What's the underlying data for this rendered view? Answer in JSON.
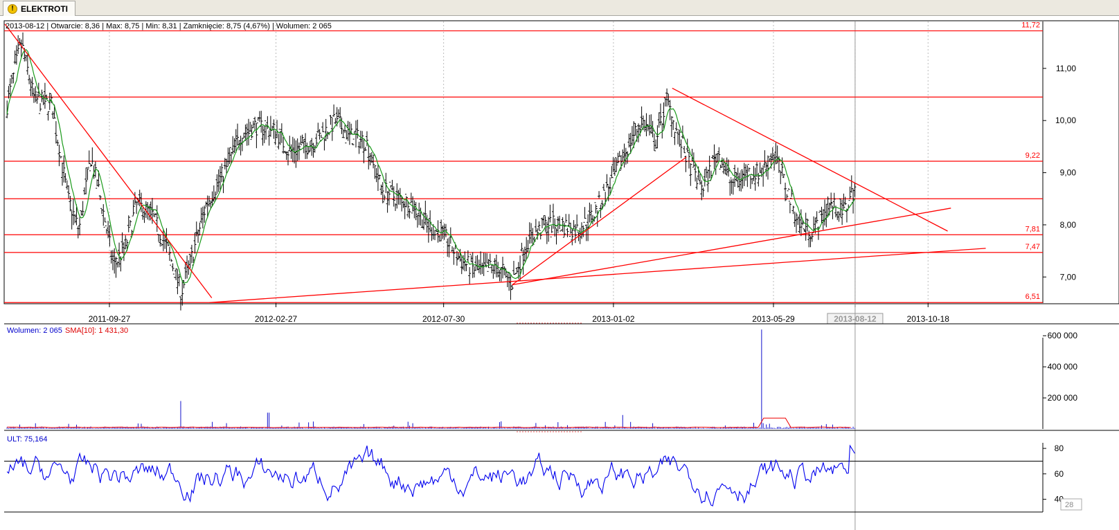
{
  "tab": {
    "label": "ELEKTROTI",
    "icon": "warning-icon"
  },
  "colors": {
    "price": "#000000",
    "sma": "#1a9a1a",
    "lines": "#ff0000",
    "volume": "#1010cc",
    "ult": "#0000ee"
  },
  "chart_data": [
    {
      "type": "bar",
      "title": "2013-08-12 | Otwarcie: 8,36 | Max: 8,75 | Min: 8,31 | Zamknięcie: 8,75 (4,67%)   | Wolumen: 2 065",
      "ylim": [
        6.5,
        11.9
      ],
      "yticks": [
        "7,00",
        "8,00",
        "9,00",
        "10,00",
        "11,00"
      ],
      "xticks": [
        "2011-09-27",
        "2012-02-27",
        "2012-07-30",
        "2013-01-02",
        "2013-05-29",
        "2013-08-12",
        "2013-10-18"
      ],
      "selected_date": "2013-08-12",
      "close_points": [
        [
          "2011-06-25",
          10.3
        ],
        [
          "2011-07-08",
          11.5
        ],
        [
          "2011-07-20",
          10.4
        ],
        [
          "2011-08-05",
          10.3
        ],
        [
          "2011-08-20",
          8.5
        ],
        [
          "2011-08-30",
          7.9
        ],
        [
          "2011-09-10",
          9.3
        ],
        [
          "2011-09-20",
          8.4
        ],
        [
          "2011-10-01",
          7.2
        ],
        [
          "2011-10-12",
          7.6
        ],
        [
          "2011-10-22",
          8.4
        ],
        [
          "2011-11-05",
          8.2
        ],
        [
          "2011-11-20",
          7.5
        ],
        [
          "2011-12-02",
          6.7
        ],
        [
          "2011-12-12",
          7.4
        ],
        [
          "2011-12-25",
          8.4
        ],
        [
          "2012-01-10",
          9.0
        ],
        [
          "2012-01-25",
          9.7
        ],
        [
          "2012-02-08",
          9.9
        ],
        [
          "2012-02-27",
          9.8
        ],
        [
          "2012-03-10",
          9.4
        ],
        [
          "2012-03-25",
          9.5
        ],
        [
          "2012-04-08",
          9.7
        ],
        [
          "2012-04-22",
          10.0
        ],
        [
          "2012-05-05",
          9.7
        ],
        [
          "2012-05-20",
          9.6
        ],
        [
          "2012-06-03",
          8.7
        ],
        [
          "2012-06-18",
          8.5
        ],
        [
          "2012-07-01",
          8.4
        ],
        [
          "2012-07-15",
          8.0
        ],
        [
          "2012-07-30",
          7.8
        ],
        [
          "2012-08-15",
          7.3
        ],
        [
          "2012-09-01",
          7.1
        ],
        [
          "2012-09-15",
          7.2
        ],
        [
          "2012-10-01",
          6.9
        ],
        [
          "2012-10-15",
          7.7
        ],
        [
          "2012-11-01",
          8.0
        ],
        [
          "2012-11-15",
          8.0
        ],
        [
          "2012-12-01",
          7.9
        ],
        [
          "2012-12-15",
          8.2
        ],
        [
          "2013-01-02",
          8.9
        ],
        [
          "2013-01-15",
          9.5
        ],
        [
          "2013-01-28",
          10.0
        ],
        [
          "2013-02-10",
          9.6
        ],
        [
          "2013-02-20",
          10.4
        ],
        [
          "2013-03-01",
          9.8
        ],
        [
          "2013-03-12",
          9.2
        ],
        [
          "2013-03-25",
          8.7
        ],
        [
          "2013-04-08",
          9.4
        ],
        [
          "2013-04-20",
          8.8
        ],
        [
          "2013-05-05",
          9.0
        ],
        [
          "2013-05-18",
          9.0
        ],
        [
          "2013-05-29",
          9.4
        ],
        [
          "2013-06-10",
          8.7
        ],
        [
          "2013-06-22",
          8.0
        ],
        [
          "2013-07-05",
          7.9
        ],
        [
          "2013-07-20",
          8.4
        ],
        [
          "2013-08-01",
          8.2
        ],
        [
          "2013-08-12",
          8.75
        ]
      ],
      "horizontal_lines": [
        {
          "value": 11.72,
          "label": "11,72"
        },
        {
          "value": 10.45,
          "label": ""
        },
        {
          "value": 9.22,
          "label": "9,22"
        },
        {
          "value": 8.5,
          "label": ""
        },
        {
          "value": 7.81,
          "label": "7,81"
        },
        {
          "value": 7.47,
          "label": "7,47"
        },
        {
          "value": 6.51,
          "label": "6,51"
        }
      ],
      "trend_lines": [
        {
          "from": [
            "2011-06-23",
            11.85
          ],
          "to": [
            "2011-12-30",
            6.6
          ]
        },
        {
          "from": [
            "2011-12-28",
            6.51
          ],
          "to": [
            "2013-12-10",
            7.55
          ]
        },
        {
          "from": [
            "2012-10-01",
            6.85
          ],
          "to": [
            "2013-03-10",
            9.3
          ]
        },
        {
          "from": [
            "2012-10-01",
            6.85
          ],
          "to": [
            "2013-11-08",
            8.32
          ]
        },
        {
          "from": [
            "2013-02-25",
            10.62
          ],
          "to": [
            "2013-11-05",
            7.88
          ]
        }
      ]
    },
    {
      "type": "bar",
      "title": "Wolumen: 2 065",
      "sma_label": "SMA[10]: 1 431,30",
      "ylim": [
        0,
        650000
      ],
      "yticks": [
        "200 000",
        "400 000",
        "600 000"
      ],
      "spikes": [
        [
          "2011-12-01",
          180000
        ],
        [
          "2012-02-20",
          105000
        ],
        [
          "2013-01-10",
          90000
        ],
        [
          "2013-05-18",
          640000
        ]
      ]
    },
    {
      "type": "line",
      "title": "ULT: 75,164",
      "ylim": [
        30,
        92
      ],
      "yticks": [
        "40",
        "60",
        "80"
      ],
      "reference_lines": [
        70,
        30
      ],
      "last_value": 75.164,
      "side_box": "28"
    }
  ]
}
